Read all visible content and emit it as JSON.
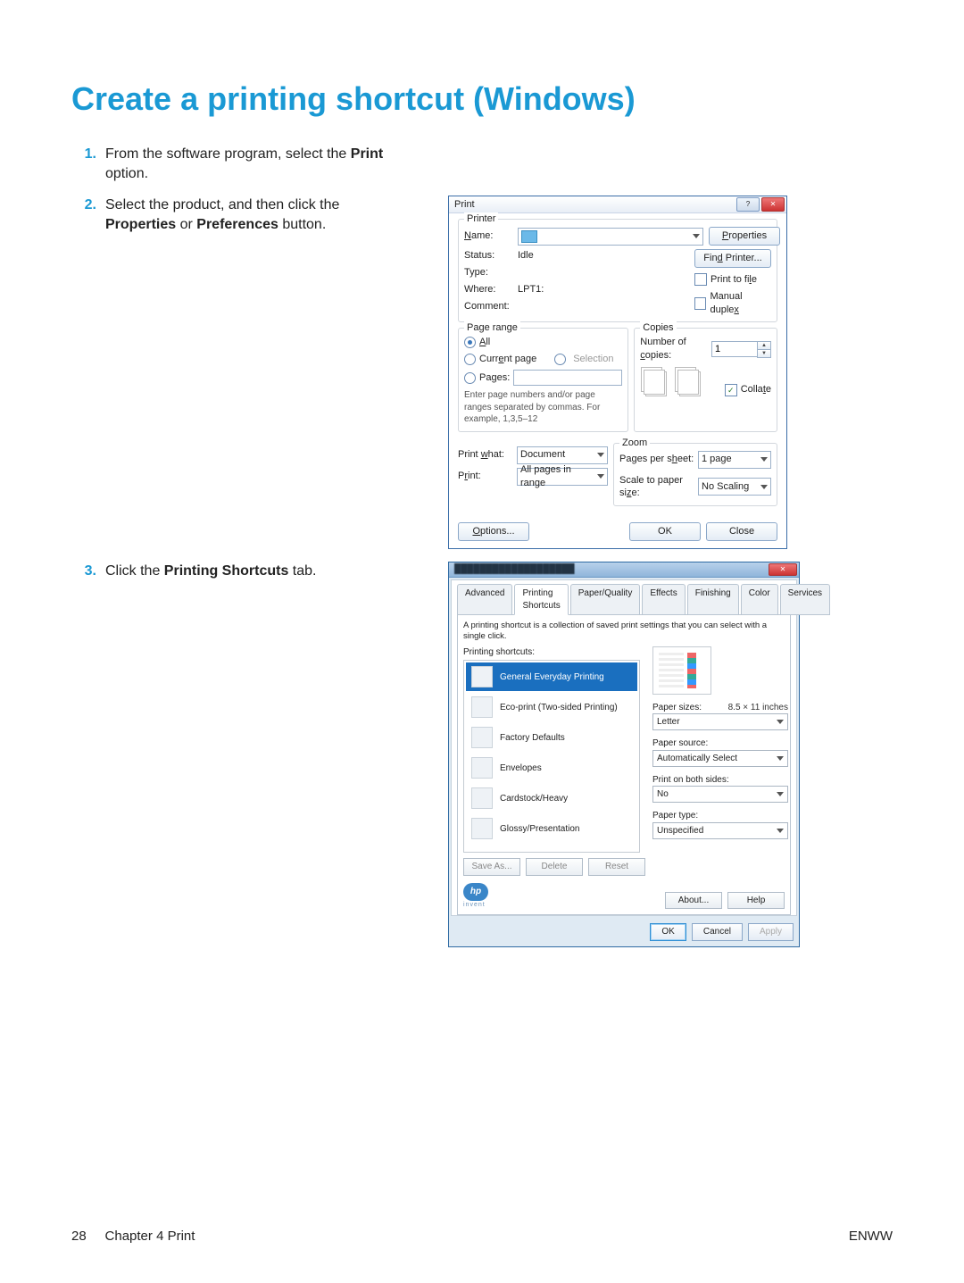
{
  "page": {
    "title": "Create a printing shortcut (Windows)",
    "footer_page": "28",
    "footer_chapter": "Chapter 4   Print",
    "footer_right": "ENWW"
  },
  "steps": {
    "s1_num": "1.",
    "s1_pre": "From the software program, select the ",
    "s1_bold": "Print",
    "s1_post": " option.",
    "s2_num": "2.",
    "s2_pre": "Select the product, and then click the ",
    "s2_bold1": "Properties",
    "s2_mid": " or ",
    "s2_bold2": "Preferences",
    "s2_post": " button.",
    "s3_num": "3.",
    "s3_pre": "Click the ",
    "s3_bold": "Printing Shortcuts",
    "s3_post": " tab."
  },
  "dlg1": {
    "title": "Print",
    "printer": {
      "legend": "Printer",
      "name_lbl": "Name:",
      "name_val": "",
      "status_lbl": "Status:",
      "status_val": "Idle",
      "type_lbl": "Type:",
      "type_val": "",
      "where_lbl": "Where:",
      "where_val": "LPT1:",
      "comment_lbl": "Comment:",
      "btn_properties": "Properties",
      "btn_find": "Find Printer...",
      "chk_file": "Print to file",
      "chk_duplex": "Manual duplex"
    },
    "range": {
      "legend": "Page range",
      "all": "All",
      "current": "Current page",
      "selection": "Selection",
      "pages": "Pages:",
      "help": "Enter page numbers and/or page ranges separated by commas. For example, 1,3,5–12"
    },
    "copies": {
      "legend": "Copies",
      "num_lbl": "Number of copies:",
      "num_val": "1",
      "collate": "Collate"
    },
    "bottom": {
      "printwhat_lbl": "Print what:",
      "printwhat_val": "Document",
      "print_lbl": "Print:",
      "print_val": "All pages in range"
    },
    "zoom": {
      "legend": "Zoom",
      "pps_lbl": "Pages per sheet:",
      "pps_val": "1 page",
      "scale_lbl": "Scale to paper size:",
      "scale_val": "No Scaling"
    },
    "footer": {
      "options": "Options...",
      "ok": "OK",
      "close": "Close"
    }
  },
  "dlg2": {
    "tabs": {
      "advanced": "Advanced",
      "shortcuts": "Printing Shortcuts",
      "paper": "Paper/Quality",
      "effects": "Effects",
      "finishing": "Finishing",
      "color": "Color",
      "services": "Services"
    },
    "hint": "A printing shortcut is a collection of saved print settings that you can select with a single click.",
    "list_label": "Printing shortcuts:",
    "shortcuts": {
      "s0": "General Everyday Printing",
      "s1": "Eco-print (Two-sided Printing)",
      "s2": "Factory Defaults",
      "s3": "Envelopes",
      "s4": "Cardstock/Heavy",
      "s5": "Glossy/Presentation"
    },
    "fields": {
      "size_lbl": "Paper sizes:",
      "size_meta": "8.5 × 11 inches",
      "size_val": "Letter",
      "src_lbl": "Paper source:",
      "src_val": "Automatically Select",
      "both_lbl": "Print on both sides:",
      "both_val": "No",
      "ptype_lbl": "Paper type:",
      "ptype_val": "Unspecified"
    },
    "btns": {
      "saveas": "Save As...",
      "delete": "Delete",
      "reset": "Reset",
      "about": "About...",
      "help": "Help",
      "ok": "OK",
      "cancel": "Cancel",
      "apply": "Apply"
    },
    "logo": "hp",
    "logo_sub": "invent"
  }
}
